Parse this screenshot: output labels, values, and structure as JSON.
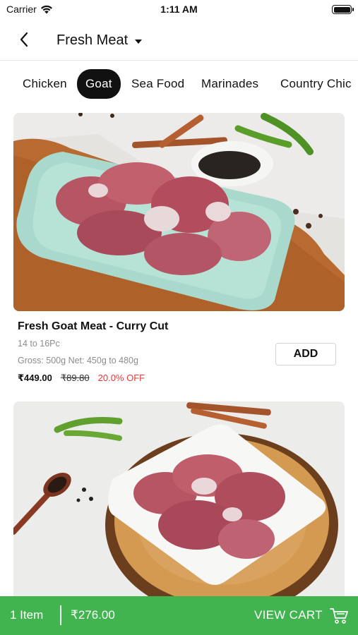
{
  "status_bar": {
    "carrier": "Carrier",
    "time": "1:11 AM"
  },
  "header": {
    "title": "Fresh Meat",
    "back_icon": "chevron-left-icon",
    "dropdown_icon": "caret-down-icon"
  },
  "tabs": [
    {
      "label": "Chicken",
      "active": false
    },
    {
      "label": "Goat",
      "active": true
    },
    {
      "label": "Sea Food",
      "active": false
    },
    {
      "label": "Marinades",
      "active": false
    },
    {
      "label": "Country Chic",
      "active": false
    }
  ],
  "products": [
    {
      "name": "Fresh Goat Meat - Curry Cut",
      "pieces": "14 to 16Pc",
      "weight": "Gross: 500g Net: 450g to 480g",
      "price": "₹449.00",
      "mrp": "₹89.80",
      "discount": "20.0% OFF",
      "add_label": "ADD"
    },
    {
      "name": "",
      "pieces": "",
      "weight": "",
      "price": "",
      "mrp": "",
      "discount": "",
      "add_label": ""
    }
  ],
  "cart": {
    "items": "1 Item",
    "total": "₹276.00",
    "view_label": "VIEW CART",
    "icon": "cart-icon"
  },
  "colors": {
    "accent_green": "#41b34f",
    "active_tab": "#111111",
    "discount_red": "#e53935"
  }
}
